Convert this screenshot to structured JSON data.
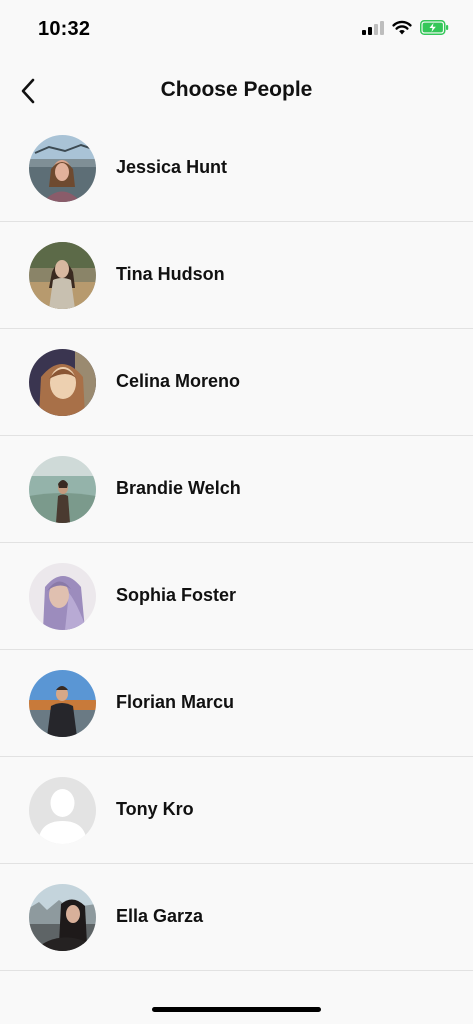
{
  "status_bar": {
    "time": "10:32",
    "signal_icon": "cellular-signal-icon",
    "wifi_icon": "wifi-icon",
    "battery_icon": "battery-charging-icon",
    "battery_color": "#34c759"
  },
  "header": {
    "back_icon": "chevron-left-icon",
    "title": "Choose People"
  },
  "people": [
    {
      "name": "Jessica Hunt",
      "avatar_colors": [
        "#8fb0c9",
        "#5a6b73",
        "#d9a58e"
      ]
    },
    {
      "name": "Tina Hudson",
      "avatar_colors": [
        "#6e6a55",
        "#3b3a30",
        "#d8b8a0"
      ]
    },
    {
      "name": "Celina Moreno",
      "avatar_colors": [
        "#3a3550",
        "#8a6a60",
        "#e8c9a0"
      ]
    },
    {
      "name": "Brandie Welch",
      "avatar_colors": [
        "#a8c4c0",
        "#7b9a8c",
        "#4a3a30"
      ]
    },
    {
      "name": "Sophia Foster",
      "avatar_colors": [
        "#ece8ec",
        "#9c8cbd",
        "#d8b6a8"
      ]
    },
    {
      "name": "Florian Marcu",
      "avatar_colors": [
        "#4a86c8",
        "#c87a3a",
        "#2a2a2e"
      ]
    },
    {
      "name": "Tony Kro",
      "avatar_colors": [
        "#e3e3e3",
        "#ffffff",
        "#ffffff"
      ]
    },
    {
      "name": "Ella Garza",
      "avatar_colors": [
        "#b8c8d0",
        "#6b6e70",
        "#1e1a1a"
      ]
    }
  ],
  "colors": {
    "background": "#f9f9f9",
    "divider": "#e2e2e2",
    "text": "#111111"
  }
}
